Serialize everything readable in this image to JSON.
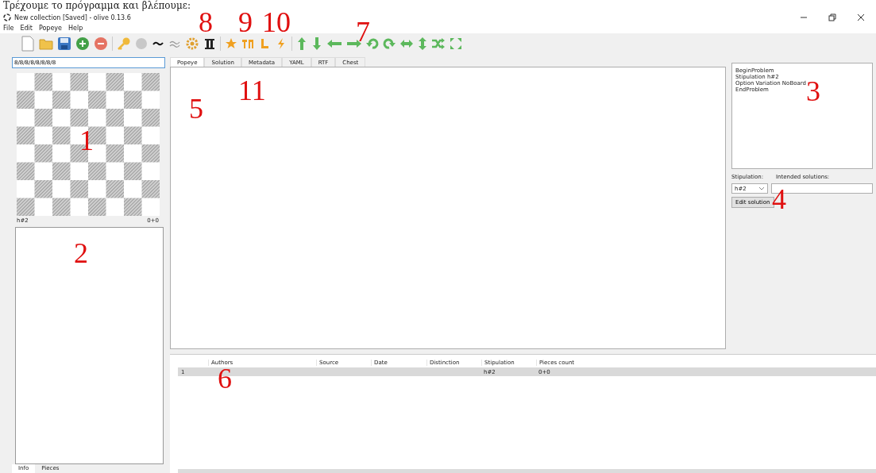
{
  "caption": "Τρέχουμε το πρόγραμμα και βλέπουμε:",
  "window": {
    "title": "New collection [Saved] - olive 0.13.6"
  },
  "menu": [
    "File",
    "Edit",
    "Popeye",
    "Help"
  ],
  "board": {
    "fen": "8/8/8/8/8/8/8/8",
    "stipulation": "h#2",
    "pieces_count": "0+0"
  },
  "left_tabs": [
    {
      "label": "Info",
      "selected": true
    },
    {
      "label": "Pieces",
      "selected": false
    }
  ],
  "tabs": [
    {
      "label": "Popeye",
      "selected": true
    },
    {
      "label": "Solution",
      "selected": false
    },
    {
      "label": "Metadata",
      "selected": false
    },
    {
      "label": "YAML",
      "selected": false
    },
    {
      "label": "RTF",
      "selected": false
    },
    {
      "label": "Chest",
      "selected": false
    }
  ],
  "popeye_input": [
    "BeginProblem",
    "Stipulation h#2",
    "Option Variation NoBoard",
    "EndProblem"
  ],
  "stipulation": {
    "label": "Stipulation:",
    "value": "h#2"
  },
  "intended_solutions": {
    "label": "Intended solutions:"
  },
  "edit_button": "Edit solution",
  "table": {
    "columns": [
      "Authors",
      "Source",
      "Date",
      "Distinction",
      "Stipulation",
      "Pieces count"
    ],
    "rows": [
      {
        "number": "1",
        "stipulation": "h#2",
        "pieces_count": "0+0",
        "selected": true
      }
    ]
  },
  "annotations": [
    "1",
    "2",
    "3",
    "4",
    "5",
    "6",
    "7",
    "8",
    "9",
    "10",
    "11"
  ]
}
